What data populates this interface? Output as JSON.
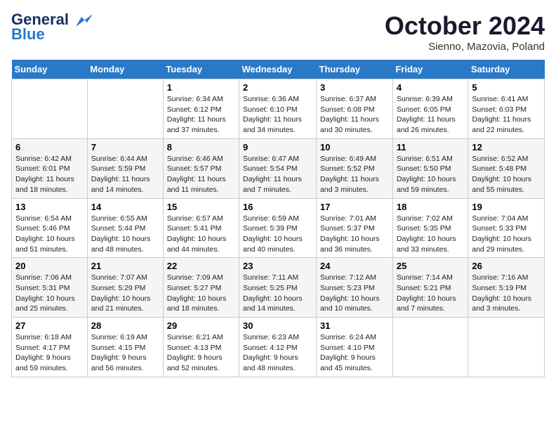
{
  "header": {
    "logo_line1": "General",
    "logo_line2": "Blue",
    "month": "October 2024",
    "location": "Sienno, Mazovia, Poland"
  },
  "weekdays": [
    "Sunday",
    "Monday",
    "Tuesday",
    "Wednesday",
    "Thursday",
    "Friday",
    "Saturday"
  ],
  "weeks": [
    [
      {
        "day": "",
        "info": ""
      },
      {
        "day": "",
        "info": ""
      },
      {
        "day": "1",
        "info": "Sunrise: 6:34 AM\nSunset: 6:12 PM\nDaylight: 11 hours and 37 minutes."
      },
      {
        "day": "2",
        "info": "Sunrise: 6:36 AM\nSunset: 6:10 PM\nDaylight: 11 hours and 34 minutes."
      },
      {
        "day": "3",
        "info": "Sunrise: 6:37 AM\nSunset: 6:08 PM\nDaylight: 11 hours and 30 minutes."
      },
      {
        "day": "4",
        "info": "Sunrise: 6:39 AM\nSunset: 6:05 PM\nDaylight: 11 hours and 26 minutes."
      },
      {
        "day": "5",
        "info": "Sunrise: 6:41 AM\nSunset: 6:03 PM\nDaylight: 11 hours and 22 minutes."
      }
    ],
    [
      {
        "day": "6",
        "info": "Sunrise: 6:42 AM\nSunset: 6:01 PM\nDaylight: 11 hours and 18 minutes."
      },
      {
        "day": "7",
        "info": "Sunrise: 6:44 AM\nSunset: 5:59 PM\nDaylight: 11 hours and 14 minutes."
      },
      {
        "day": "8",
        "info": "Sunrise: 6:46 AM\nSunset: 5:57 PM\nDaylight: 11 hours and 11 minutes."
      },
      {
        "day": "9",
        "info": "Sunrise: 6:47 AM\nSunset: 5:54 PM\nDaylight: 11 hours and 7 minutes."
      },
      {
        "day": "10",
        "info": "Sunrise: 6:49 AM\nSunset: 5:52 PM\nDaylight: 11 hours and 3 minutes."
      },
      {
        "day": "11",
        "info": "Sunrise: 6:51 AM\nSunset: 5:50 PM\nDaylight: 10 hours and 59 minutes."
      },
      {
        "day": "12",
        "info": "Sunrise: 6:52 AM\nSunset: 5:48 PM\nDaylight: 10 hours and 55 minutes."
      }
    ],
    [
      {
        "day": "13",
        "info": "Sunrise: 6:54 AM\nSunset: 5:46 PM\nDaylight: 10 hours and 51 minutes."
      },
      {
        "day": "14",
        "info": "Sunrise: 6:55 AM\nSunset: 5:44 PM\nDaylight: 10 hours and 48 minutes."
      },
      {
        "day": "15",
        "info": "Sunrise: 6:57 AM\nSunset: 5:41 PM\nDaylight: 10 hours and 44 minutes."
      },
      {
        "day": "16",
        "info": "Sunrise: 6:59 AM\nSunset: 5:39 PM\nDaylight: 10 hours and 40 minutes."
      },
      {
        "day": "17",
        "info": "Sunrise: 7:01 AM\nSunset: 5:37 PM\nDaylight: 10 hours and 36 minutes."
      },
      {
        "day": "18",
        "info": "Sunrise: 7:02 AM\nSunset: 5:35 PM\nDaylight: 10 hours and 33 minutes."
      },
      {
        "day": "19",
        "info": "Sunrise: 7:04 AM\nSunset: 5:33 PM\nDaylight: 10 hours and 29 minutes."
      }
    ],
    [
      {
        "day": "20",
        "info": "Sunrise: 7:06 AM\nSunset: 5:31 PM\nDaylight: 10 hours and 25 minutes."
      },
      {
        "day": "21",
        "info": "Sunrise: 7:07 AM\nSunset: 5:29 PM\nDaylight: 10 hours and 21 minutes."
      },
      {
        "day": "22",
        "info": "Sunrise: 7:09 AM\nSunset: 5:27 PM\nDaylight: 10 hours and 18 minutes."
      },
      {
        "day": "23",
        "info": "Sunrise: 7:11 AM\nSunset: 5:25 PM\nDaylight: 10 hours and 14 minutes."
      },
      {
        "day": "24",
        "info": "Sunrise: 7:12 AM\nSunset: 5:23 PM\nDaylight: 10 hours and 10 minutes."
      },
      {
        "day": "25",
        "info": "Sunrise: 7:14 AM\nSunset: 5:21 PM\nDaylight: 10 hours and 7 minutes."
      },
      {
        "day": "26",
        "info": "Sunrise: 7:16 AM\nSunset: 5:19 PM\nDaylight: 10 hours and 3 minutes."
      }
    ],
    [
      {
        "day": "27",
        "info": "Sunrise: 6:18 AM\nSunset: 4:17 PM\nDaylight: 9 hours and 59 minutes."
      },
      {
        "day": "28",
        "info": "Sunrise: 6:19 AM\nSunset: 4:15 PM\nDaylight: 9 hours and 56 minutes."
      },
      {
        "day": "29",
        "info": "Sunrise: 6:21 AM\nSunset: 4:13 PM\nDaylight: 9 hours and 52 minutes."
      },
      {
        "day": "30",
        "info": "Sunrise: 6:23 AM\nSunset: 4:12 PM\nDaylight: 9 hours and 48 minutes."
      },
      {
        "day": "31",
        "info": "Sunrise: 6:24 AM\nSunset: 4:10 PM\nDaylight: 9 hours and 45 minutes."
      },
      {
        "day": "",
        "info": ""
      },
      {
        "day": "",
        "info": ""
      }
    ]
  ]
}
